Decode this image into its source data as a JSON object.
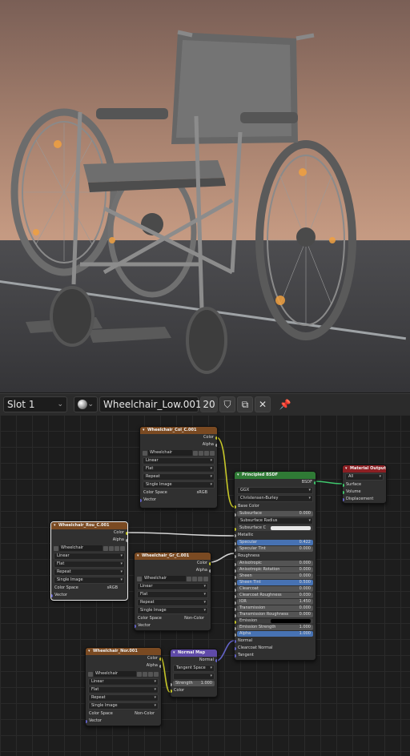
{
  "toolbar": {
    "slot": "Slot 1",
    "material": "Wheelchair_Low.001",
    "users": "20"
  },
  "nodes": {
    "tex1": {
      "title": "Wheelchair_Col_C.001",
      "out_color": "Color",
      "out_alpha": "Alpha",
      "image": "Wheelchair",
      "interp": "Linear",
      "proj": "Flat",
      "ext": "Repeat",
      "source": "Single Image",
      "cs_label": "Color Space",
      "cs_value": "sRGB",
      "vector": "Vector"
    },
    "tex2": {
      "title": "Wheelchair_Rou_C.001",
      "out_color": "Color",
      "out_alpha": "Alpha",
      "image": "Wheelchair",
      "interp": "Linear",
      "proj": "Flat",
      "ext": "Repeat",
      "source": "Single Image",
      "cs_label": "Color Space",
      "cs_value": "sRGB",
      "vector": "Vector"
    },
    "tex3": {
      "title": "Wheelchair_Gr_C.001",
      "out_color": "Color",
      "out_alpha": "Alpha",
      "image": "Wheelchair",
      "interp": "Linear",
      "proj": "Flat",
      "ext": "Repeat",
      "source": "Single Image",
      "cs_label": "Color Space",
      "cs_value": "Non-Color",
      "vector": "Vector"
    },
    "tex4": {
      "title": "Wheelchair_Nor.001",
      "out_color": "Color",
      "out_alpha": "Alpha",
      "image": "Wheelchair",
      "interp": "Linear",
      "proj": "Flat",
      "ext": "Repeat",
      "source": "Single Image",
      "cs_label": "Color Space",
      "cs_value": "Non-Color",
      "vector": "Vector"
    },
    "normal_map": {
      "title": "Normal Map",
      "out": "Normal",
      "space": "Tangent Space",
      "strength_label": "Strength",
      "strength_value": "1.000",
      "color": "Color"
    },
    "bsdf": {
      "title": "Principled BSDF",
      "out": "BSDF",
      "distribution": "GGX",
      "subsurface_method": "Christensen-Burley",
      "rows": [
        {
          "label": "Base Color",
          "value": "",
          "type": "socket"
        },
        {
          "label": "Subsurface",
          "value": "0.000",
          "type": "field"
        },
        {
          "label": "Subsurface Radius",
          "value": "",
          "type": "drop"
        },
        {
          "label": "Subsurface C",
          "value": "",
          "type": "color"
        },
        {
          "label": "Metallic",
          "value": "",
          "type": "socket"
        },
        {
          "label": "Specular",
          "value": "0.422",
          "type": "blue"
        },
        {
          "label": "Specular Tint",
          "value": "0.000",
          "type": "field"
        },
        {
          "label": "Roughness",
          "value": "",
          "type": "socket"
        },
        {
          "label": "Anisotropic",
          "value": "0.000",
          "type": "field"
        },
        {
          "label": "Anisotropic Rotation",
          "value": "0.000",
          "type": "field"
        },
        {
          "label": "Sheen",
          "value": "0.000",
          "type": "field"
        },
        {
          "label": "Sheen Tint",
          "value": "0.500",
          "type": "blue"
        },
        {
          "label": "Clearcoat",
          "value": "0.000",
          "type": "field"
        },
        {
          "label": "Clearcoat Roughness",
          "value": "0.030",
          "type": "field"
        },
        {
          "label": "IOR",
          "value": "1.450",
          "type": "field"
        },
        {
          "label": "Transmission",
          "value": "0.000",
          "type": "field"
        },
        {
          "label": "Transmission Roughness",
          "value": "0.000",
          "type": "field"
        },
        {
          "label": "Emission",
          "value": "",
          "type": "black"
        },
        {
          "label": "Emission Strength",
          "value": "1.000",
          "type": "field"
        },
        {
          "label": "Alpha",
          "value": "1.000",
          "type": "blue"
        },
        {
          "label": "Normal",
          "value": "",
          "type": "socket"
        },
        {
          "label": "Clearcoat Normal",
          "value": "",
          "type": "socket"
        },
        {
          "label": "Tangent",
          "value": "",
          "type": "socket"
        }
      ]
    },
    "output": {
      "title": "Material Output",
      "target": "All",
      "surface": "Surface",
      "volume": "Volume",
      "displacement": "Displacement"
    }
  }
}
